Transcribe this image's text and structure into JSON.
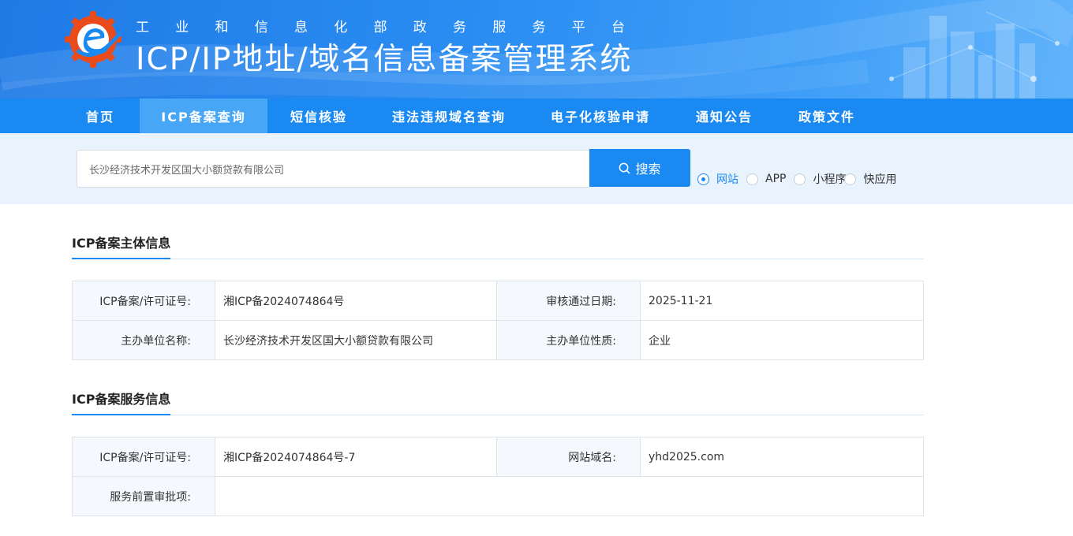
{
  "header": {
    "subtitle_chars": [
      "工",
      "业",
      "和",
      "信",
      "息",
      "化",
      "部",
      "政",
      "务",
      "服",
      "务",
      "平",
      "台"
    ],
    "title": "ICP/IP地址/域名信息备案管理系统"
  },
  "nav": {
    "items": [
      {
        "label": "首页"
      },
      {
        "label": "ICP备案查询"
      },
      {
        "label": "短信核验"
      },
      {
        "label": "违法违规域名查询"
      },
      {
        "label": "电子化核验申请"
      },
      {
        "label": "通知公告"
      },
      {
        "label": "政策文件"
      }
    ],
    "active_index": 1
  },
  "search": {
    "value": "长沙经济技术开发区国大小额贷款有限公司",
    "button_label": "搜索",
    "radios": [
      {
        "label": "网站",
        "checked": true
      },
      {
        "label": "APP",
        "checked": false
      },
      {
        "label": "小程序",
        "checked": false
      },
      {
        "label": "快应用",
        "checked": false
      }
    ]
  },
  "subject": {
    "title": "ICP备案主体信息",
    "license_label": "ICP备案/许可证号:",
    "license_value": "湘ICP备2024074864号",
    "date_label": "审核通过日期:",
    "date_value": "2025-11-21",
    "org_label": "主办单位名称:",
    "org_value": "长沙经济技术开发区国大小额贷款有限公司",
    "nature_label": "主办单位性质:",
    "nature_value": "企业"
  },
  "service": {
    "title": "ICP备案服务信息",
    "license_label": "ICP备案/许可证号:",
    "license_value": "湘ICP备2024074864号-7",
    "domain_label": "网站域名:",
    "domain_value": "yhd2025.com",
    "approval_label": "服务前置审批项:",
    "approval_value": ""
  },
  "colors": {
    "primary": "#1a89f2",
    "nav_active": "#47a7f6",
    "search_band": "#e9f3fd",
    "key_cell": "#f5f9fd"
  }
}
